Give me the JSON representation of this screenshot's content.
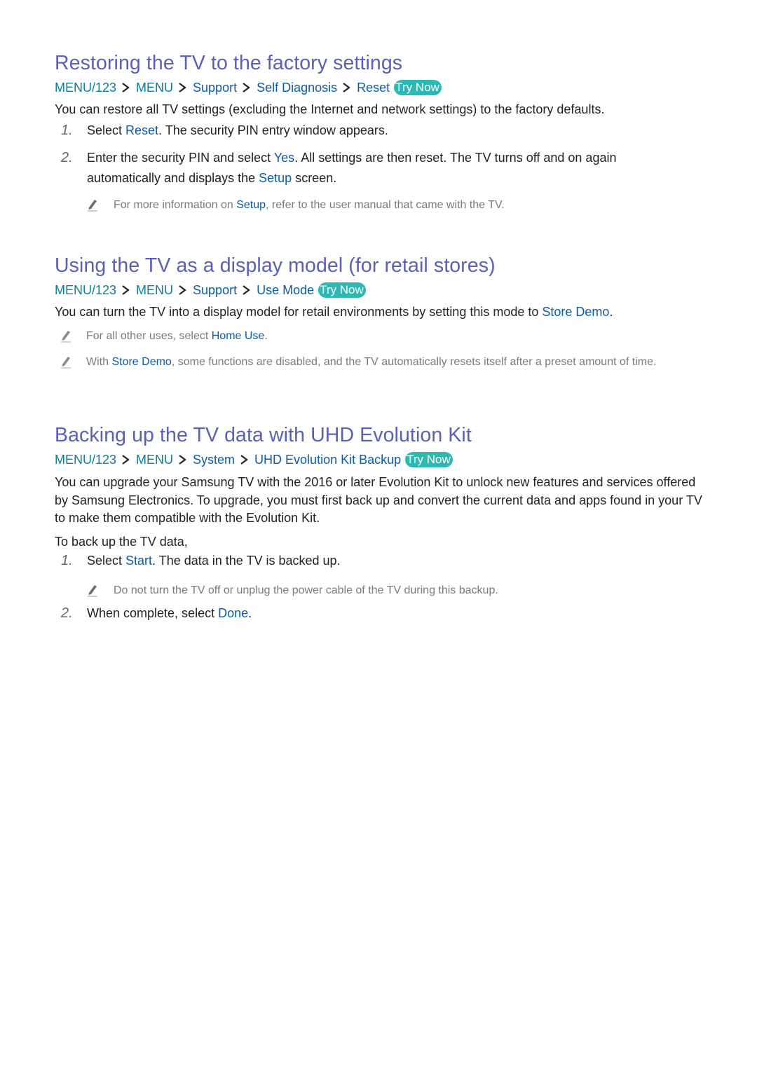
{
  "colors": {
    "heading": "#5a5fb8",
    "path_root": "#0f7d96",
    "path_item": "#0d5ba6",
    "try_now_bg": "#2cb8b3",
    "body_text": "#222222",
    "note_text": "#7a7a7a"
  },
  "try_now_label": "Try Now",
  "sections": [
    {
      "title": "Restoring the TV to the factory settings",
      "path": [
        "MENU/123",
        "MENU",
        "Support",
        "Self Diagnosis",
        "Reset"
      ],
      "intro": "You can restore all TV settings (excluding the Internet and network settings) to the factory defaults.",
      "steps": [
        {
          "num": "1.",
          "pre": "Select ",
          "hl": "Reset",
          "post": ". The security PIN entry window appears."
        },
        {
          "num": "2.",
          "pre": "Enter the security PIN and select ",
          "hl": "Yes",
          "post": ". All settings are then reset. The TV turns off and on again",
          "line2_pre": "automatically and displays the ",
          "line2_hl": "Setup",
          "line2_post": " screen."
        }
      ],
      "notes": [
        {
          "pre": "For more information on ",
          "hl": "Setup",
          "post": ", refer to the user manual that came with the TV."
        }
      ]
    },
    {
      "title": "Using the TV as a display model (for retail stores)",
      "path": [
        "MENU/123",
        "MENU",
        "Support",
        "Use Mode"
      ],
      "intro_pre": "You can turn the TV into a display model for retail environments by setting this mode to ",
      "intro_hl": "Store Demo",
      "intro_post": ".",
      "notes": [
        {
          "pre": "For all other uses, select ",
          "hl": "Home Use",
          "post": "."
        },
        {
          "pre": "With ",
          "hl": "Store Demo",
          "post": ", some functions are disabled, and the TV automatically resets itself after a preset amount of time."
        }
      ]
    },
    {
      "title": "Backing up the TV data with UHD Evolution Kit",
      "path": [
        "MENU/123",
        "MENU",
        "System",
        "UHD Evolution Kit Backup"
      ],
      "intro": "You can upgrade your Samsung TV with the 2016 or later Evolution Kit to unlock new features and services offered by Samsung Electronics. To upgrade, you must first back up and convert the current data and apps found in your TV to make them compatible with the Evolution Kit.",
      "lead": "To back up the TV data,",
      "steps": [
        {
          "num": "1.",
          "pre": "Select ",
          "hl": "Start",
          "post": ". The data in the TV is backed up."
        },
        {
          "num": "2.",
          "pre": "When complete, select ",
          "hl": "Done",
          "post": "."
        }
      ],
      "notes": [
        {
          "pre": "Do not turn the TV off or unplug the power cable of the TV during this backup."
        }
      ]
    }
  ]
}
